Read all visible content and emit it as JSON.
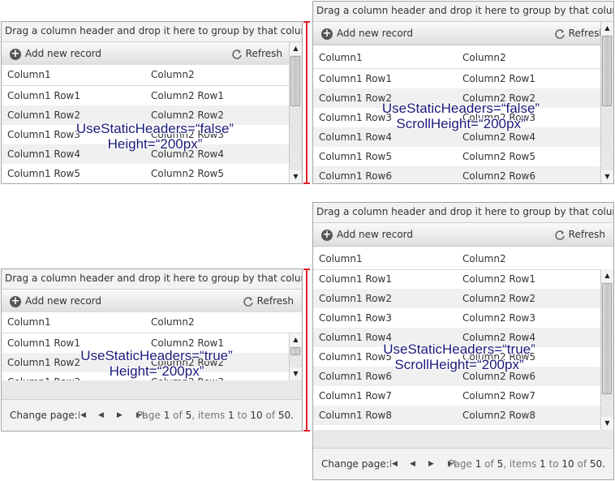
{
  "grid": {
    "group_panel_text": "Drag a column header and drop it here to group by that column",
    "add_label": "Add new record",
    "refresh_label": "Refresh",
    "columns": [
      "Column1",
      "Column2"
    ]
  },
  "rows": [
    [
      "Column1 Row1",
      "Column2 Row1"
    ],
    [
      "Column1 Row2",
      "Column2 Row2"
    ],
    [
      "Column1 Row3",
      "Column2 Row3"
    ],
    [
      "Column1 Row4",
      "Column2 Row4"
    ],
    [
      "Column1 Row5",
      "Column2 Row5"
    ],
    [
      "Column1 Row6",
      "Column2 Row6"
    ],
    [
      "Column1 Row7",
      "Column2 Row7"
    ],
    [
      "Column1 Row8",
      "Column2 Row8"
    ]
  ],
  "pager": {
    "change_page": "Change page:",
    "info_page": "Page",
    "info_page_num": "1",
    "info_of": "of",
    "info_pages": "5",
    "info_items": "items",
    "info_from": "1",
    "info_to": "to",
    "info_to_num": "10",
    "info_of2": "of",
    "info_total": "50."
  },
  "labels": {
    "a_line1": "UseStaticHeaders=“false”",
    "a_line2": "Height=“200px”",
    "b_line1": "UseStaticHeaders=“false”",
    "b_line2": "ScrollHeight=“200px”",
    "c_line1": "UseStaticHeaders=“true”",
    "c_line2": "Height=“200px”",
    "d_line1": "UseStaticHeaders=“true”",
    "d_line2": "ScrollHeight=“200px”"
  },
  "colors": {
    "annotation": "#1a1a7a",
    "marker": "#e0202a"
  }
}
